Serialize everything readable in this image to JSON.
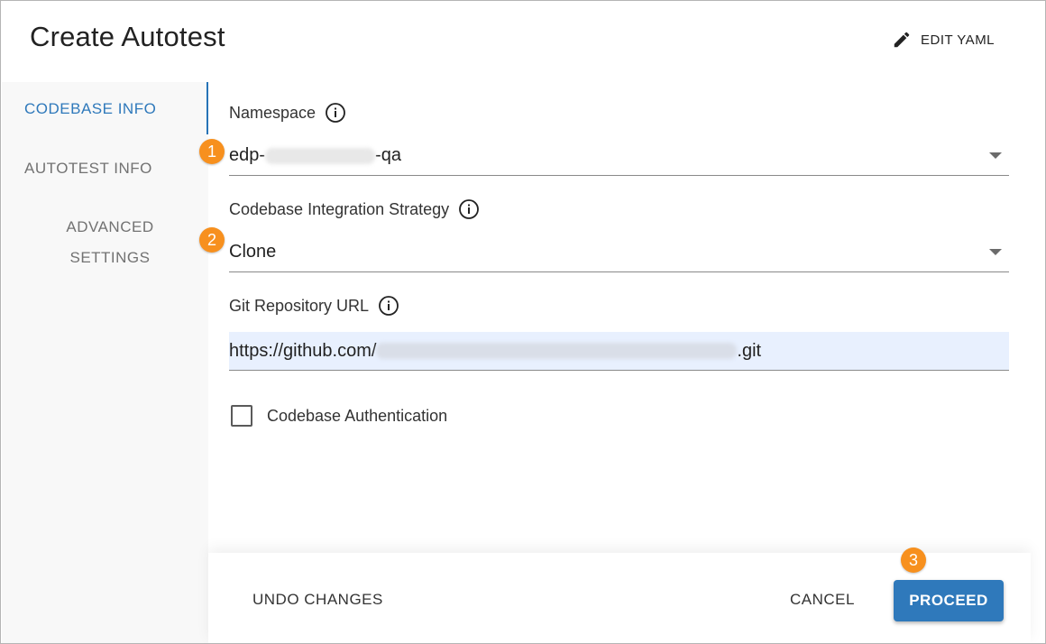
{
  "dialog": {
    "title": "Create Autotest",
    "edit_yaml_label": "EDIT YAML",
    "edit_icon": "pencil-icon"
  },
  "sidebar": {
    "items": [
      {
        "label": "CODEBASE INFO",
        "active": true
      },
      {
        "label": "AUTOTEST INFO",
        "active": false
      },
      {
        "label_line1": "ADVANCED",
        "label_line2": "SETTINGS",
        "active": false
      }
    ],
    "active_color": "#2f79bb"
  },
  "form": {
    "namespace": {
      "label": "Namespace",
      "value_prefix": "edp-",
      "value_suffix": "-qa",
      "info_icon": "info-icon"
    },
    "strategy": {
      "label": "Codebase Integration Strategy",
      "value": "Clone",
      "info_icon": "info-icon"
    },
    "git_url": {
      "label": "Git Repository URL",
      "value_prefix": "https://github.com/",
      "value_suffix": ".git",
      "info_icon": "info-icon"
    },
    "auth": {
      "label": "Codebase Authentication",
      "checked": false
    }
  },
  "markers": [
    "1",
    "2",
    "3"
  ],
  "footer": {
    "undo_label": "UNDO CHANGES",
    "cancel_label": "CANCEL",
    "proceed_label": "PROCEED",
    "primary_color": "#2f79bb"
  }
}
